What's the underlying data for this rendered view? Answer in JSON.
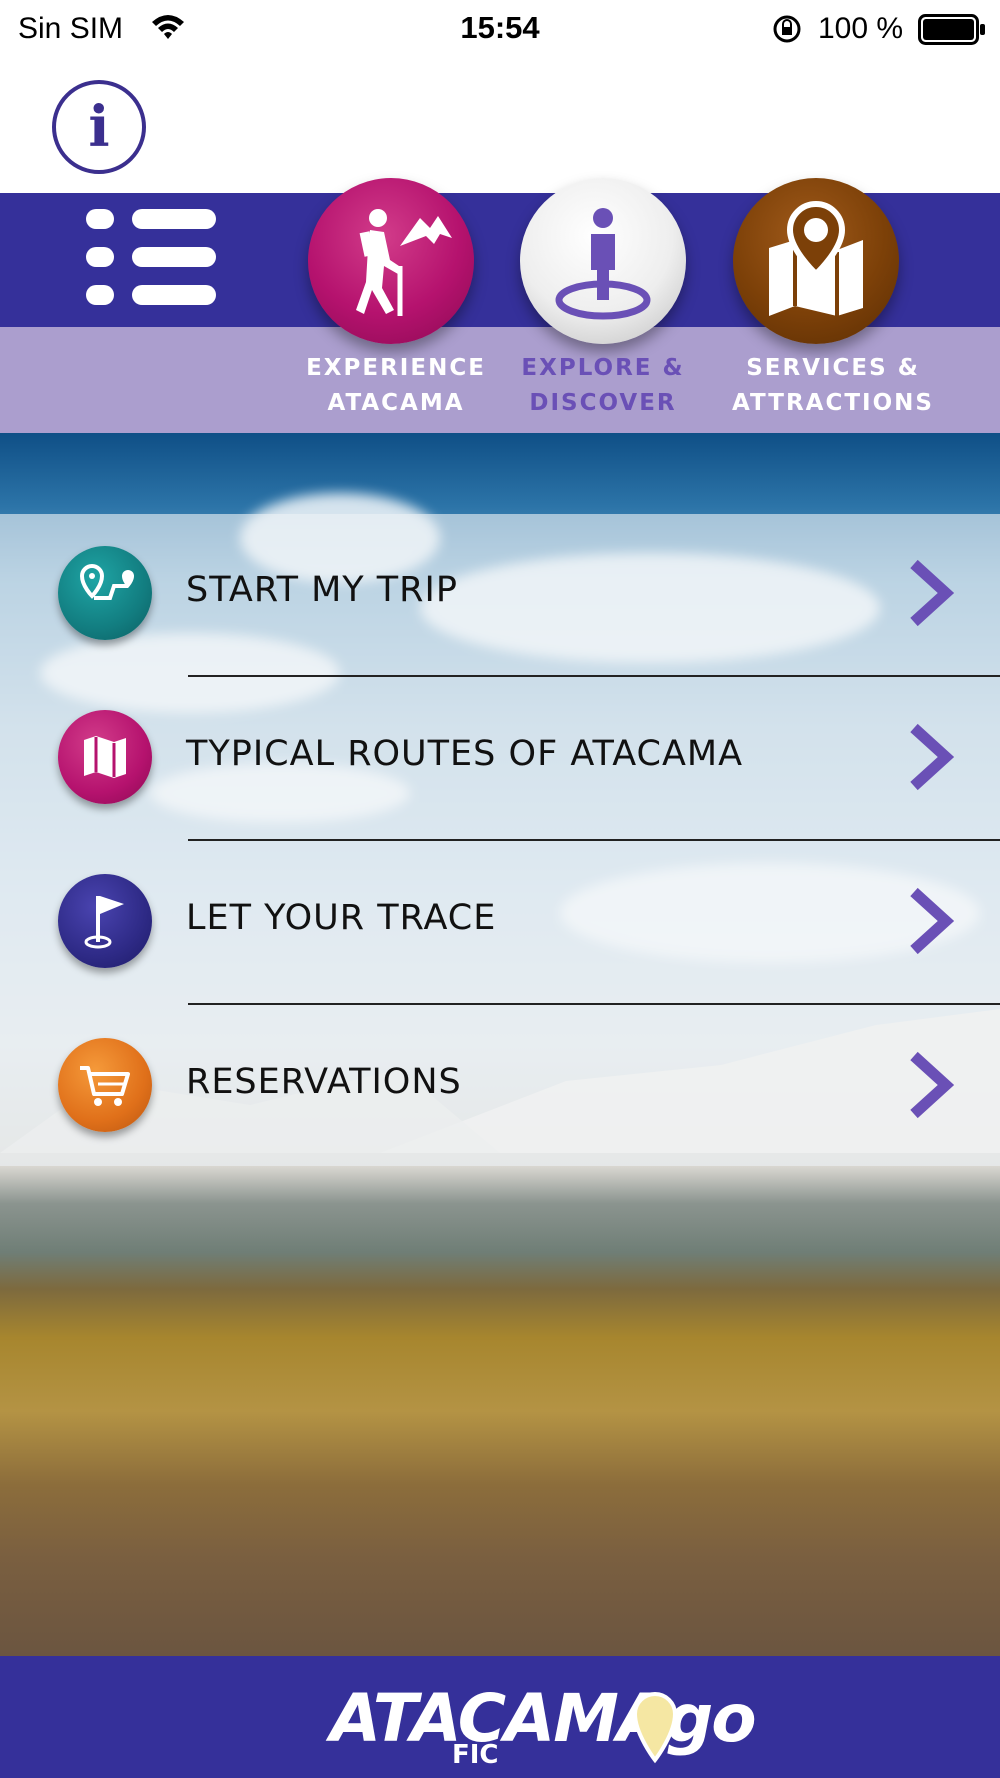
{
  "status_bar": {
    "carrier": "Sin SIM",
    "time": "15:54",
    "battery_percent": "100 %",
    "icons": [
      "wifi-icon",
      "orientation-lock-icon",
      "battery-icon"
    ]
  },
  "header": {
    "info_icon": "info-icon",
    "menu_icon": "list-menu-icon"
  },
  "nav": {
    "items": [
      {
        "line1": "EXPERIENCE",
        "line2": "ATACAMA",
        "icon": "hiker-icon",
        "color": "#b5126e",
        "selected": false
      },
      {
        "line1": "EXPLORE &",
        "line2": "DISCOVER",
        "icon": "person-location-icon",
        "color": "#ffffff",
        "selected": true
      },
      {
        "line1": "SERVICES &",
        "line2": "ATTRACTIONS",
        "icon": "map-pin-icon",
        "color": "#7c4008",
        "selected": false
      }
    ],
    "band_color": "#35309a",
    "sub_band_color": "#ab9ece",
    "selected_label_color": "#6a50b6"
  },
  "menu": {
    "items": [
      {
        "label": "START MY TRIP",
        "icon": "route-icon",
        "color": "#127d80"
      },
      {
        "label": "TYPICAL ROUTES OF ATACAMA",
        "icon": "map-icon",
        "color": "#b5126e"
      },
      {
        "label": "LET YOUR TRACE",
        "icon": "flag-icon",
        "color": "#2e2a86"
      },
      {
        "label": "RESERVATIONS",
        "icon": "cart-icon",
        "color": "#e0701a"
      }
    ],
    "chevron_color": "#6a50b6"
  },
  "footer": {
    "logo_text": "ATACAMAgo",
    "logo_subtext": "FIC"
  }
}
